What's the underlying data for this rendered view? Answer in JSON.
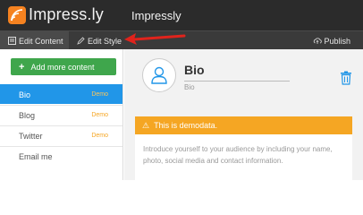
{
  "app": {
    "logo_text": "Impress.ly",
    "page_title": "Impressly"
  },
  "tabs": {
    "edit_content": "Edit Content",
    "edit_style": "Edit Style",
    "publish": "Publish"
  },
  "sidebar": {
    "add_button": "Add more content",
    "items": [
      {
        "label": "Bio",
        "badge": "Demo",
        "active": true
      },
      {
        "label": "Blog",
        "badge": "Demo"
      },
      {
        "label": "Twitter",
        "badge": "Demo"
      },
      {
        "label": "Email me",
        "badge": ""
      }
    ]
  },
  "main": {
    "title": "Bio",
    "subtitle": "Bio",
    "demo_notice": "This is demodata.",
    "intro_text": "Introduce yourself to your audience by including your name, photo, social media and contact information."
  },
  "colors": {
    "topbar": "#2b2b2b",
    "accent_orange": "#f5a623",
    "logo_orange": "#f58220",
    "active_blue": "#2196e8",
    "add_green": "#3fa64c",
    "arrow_red": "#e0231c"
  },
  "icons": [
    "logo-icon",
    "edit-content-icon",
    "pencil-icon",
    "cloud-upload-icon",
    "plus-icon",
    "user-icon",
    "trash-icon",
    "warning-icon"
  ]
}
